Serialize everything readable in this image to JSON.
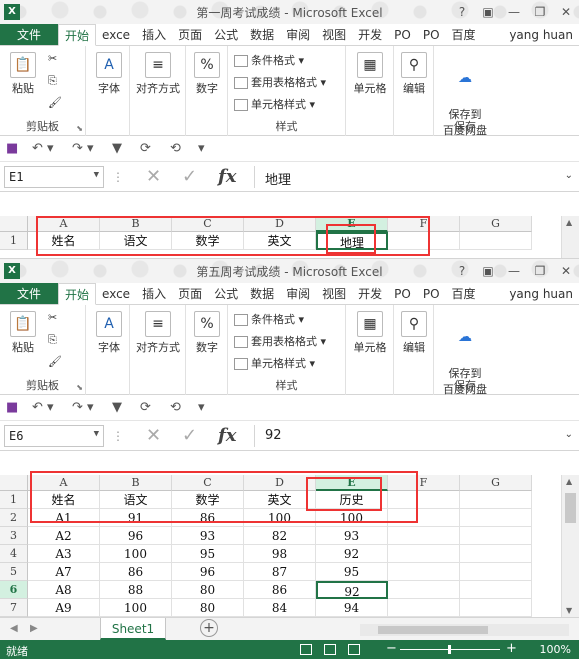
{
  "window1": {
    "title": "第一周考试成绩 - Microsoft Excel",
    "tabs": [
      "开始",
      "exce",
      "插入",
      "页面",
      "公式",
      "数据",
      "审阅",
      "视图",
      "开发",
      "PO",
      "PO",
      "百度"
    ],
    "file_tab": "文件",
    "user": "yang huan",
    "namebox": "E1",
    "formula": "地理",
    "columns": [
      "A",
      "B",
      "C",
      "D",
      "E",
      "F",
      "G"
    ],
    "rows": [
      {
        "num": "1",
        "cells": [
          "姓名",
          "语文",
          "数学",
          "英文",
          "地理",
          "",
          ""
        ]
      }
    ]
  },
  "window2": {
    "title": "第五周考试成绩 - Microsoft Excel",
    "tabs": [
      "开始",
      "exce",
      "插入",
      "页面",
      "公式",
      "数据",
      "审阅",
      "视图",
      "开发",
      "PO",
      "PO",
      "百度"
    ],
    "file_tab": "文件",
    "user": "yang huan",
    "namebox": "E6",
    "formula": "92",
    "columns": [
      "A",
      "B",
      "C",
      "D",
      "E",
      "F",
      "G"
    ],
    "rows": [
      {
        "num": "1",
        "cells": [
          "姓名",
          "语文",
          "数学",
          "英文",
          "历史",
          "",
          ""
        ]
      },
      {
        "num": "2",
        "cells": [
          "A1",
          "91",
          "86",
          "100",
          "100",
          "",
          ""
        ]
      },
      {
        "num": "3",
        "cells": [
          "A2",
          "96",
          "93",
          "82",
          "93",
          "",
          ""
        ]
      },
      {
        "num": "4",
        "cells": [
          "A3",
          "100",
          "95",
          "98",
          "92",
          "",
          ""
        ]
      },
      {
        "num": "5",
        "cells": [
          "A7",
          "86",
          "96",
          "87",
          "95",
          "",
          ""
        ]
      },
      {
        "num": "6",
        "cells": [
          "A8",
          "88",
          "80",
          "86",
          "92",
          "",
          ""
        ]
      },
      {
        "num": "7",
        "cells": [
          "A9",
          "100",
          "80",
          "84",
          "94",
          "",
          ""
        ]
      }
    ],
    "sheet_tab": "Sheet1",
    "status_ready": "就绪",
    "zoom": "100%"
  },
  "ribbon": {
    "clipboard": {
      "paste": "粘贴",
      "label": "剪贴板"
    },
    "font": "字体",
    "align": "对齐方式",
    "number": "数字",
    "cond_format": "条件格式",
    "table_format": "套用表格格式",
    "cell_style": "单元格样式",
    "styles_label": "样式",
    "cells": "单元格",
    "edit": "编辑",
    "save_baidu": "保存到\n百度网盘",
    "save_label": "保存"
  },
  "icons": {
    "font_icon": "font-color-icon",
    "align_icon": "align-lines-icon",
    "number_icon": "percent-icon"
  },
  "colors": {
    "excel_green": "#217346",
    "highlight_red": "#e33333"
  }
}
